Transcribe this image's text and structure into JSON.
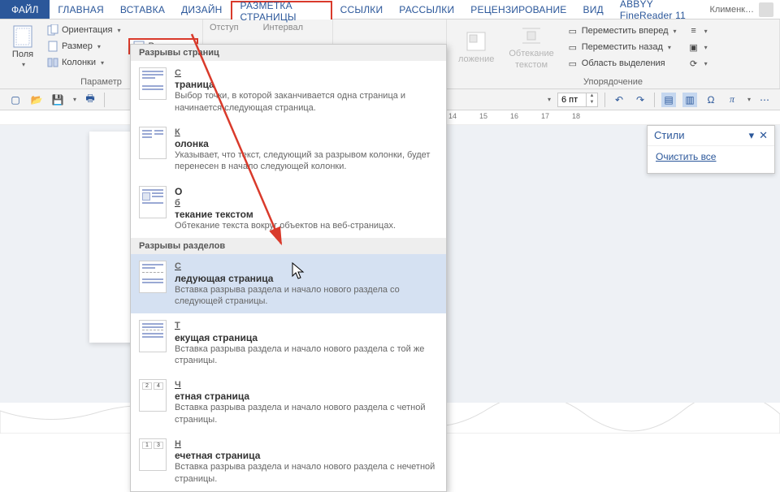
{
  "tabs": {
    "file": "ФАЙЛ",
    "items": [
      "ГЛАВНАЯ",
      "ВСТАВКА",
      "ДИЗАЙН",
      "РАЗМЕТКА СТРАНИЦЫ",
      "ССЫЛКИ",
      "РАССЫЛКИ",
      "РЕЦЕНЗИРОВАНИЕ",
      "ВИД",
      "ABBYY FineReader 11"
    ],
    "active_index": 3,
    "user": "Клименк…"
  },
  "ribbon": {
    "group_params": {
      "fields": "Поля",
      "orientation": "Ориентация",
      "size": "Размер",
      "columns": "Колонки",
      "breaks": "Разрывы",
      "label": "Параметр"
    },
    "group_indent": {
      "indent": "Отступ",
      "interval": "Интервал",
      "val": "6 пт"
    },
    "group_arrange": {
      "position": "ложение",
      "wrap1": "Обтекание",
      "wrap2": "текстом",
      "fwd": "Переместить вперед",
      "back": "Переместить назад",
      "sel": "Область выделения",
      "label": "Упорядочение"
    }
  },
  "gallery": {
    "head1": "Разрывы страниц",
    "items1": [
      {
        "title": "Страница",
        "ukey": "С",
        "desc": "Выбор точки, в которой заканчивается одна страница и начинается следующая страница."
      },
      {
        "title": "Колонка",
        "ukey": "К",
        "desc": "Указывает, что текст, следующий за разрывом колонки, будет перенесен в начало следующей колонки."
      },
      {
        "title": "Обтекание текстом",
        "ukey": "б",
        "desc": "Обтекание текста вокруг объектов на веб-страницах."
      }
    ],
    "head2": "Разрывы разделов",
    "items2": [
      {
        "title": "Следующая страница",
        "ukey": "С",
        "desc": "Вставка разрыва раздела и начало нового раздела со следующей страницы.",
        "hover": true
      },
      {
        "title": "Текущая страница",
        "ukey": "Т",
        "desc": "Вставка разрыва раздела и начало нового раздела с той же страницы."
      },
      {
        "title": "Четная страница",
        "ukey": "Ч",
        "desc": "Вставка разрыва раздела и начало нового раздела с четной страницы."
      },
      {
        "title": "Нечетная страница",
        "ukey": "Н",
        "desc": "Вставка разрыва раздела и начало нового раздела с нечетной страницы."
      }
    ]
  },
  "ruler": {
    "marks": [
      "14",
      "15",
      "16",
      "17",
      "18"
    ]
  },
  "styles": {
    "title": "Стили",
    "clear": "Очистить все"
  }
}
